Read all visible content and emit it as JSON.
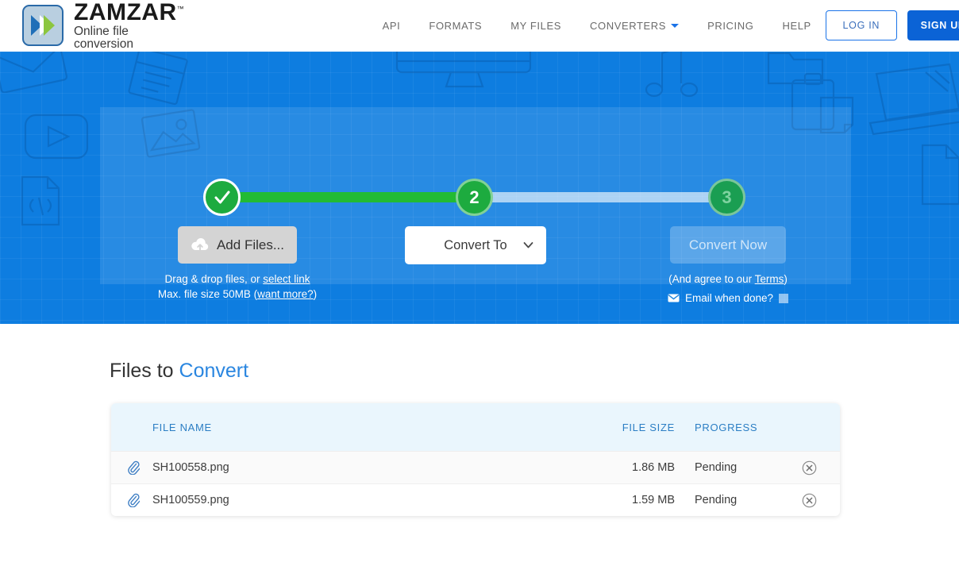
{
  "header": {
    "logo": {
      "name": "ZAMZAR",
      "tm": "™",
      "tagline": "Online file conversion"
    },
    "nav": [
      {
        "label": "API",
        "icon": ""
      },
      {
        "label": "FORMATS",
        "icon": ""
      },
      {
        "label": "MY FILES",
        "icon": ""
      },
      {
        "label": "CONVERTERS",
        "icon": "chevron-down-icon"
      },
      {
        "label": "PRICING",
        "icon": ""
      },
      {
        "label": "HELP",
        "icon": ""
      }
    ],
    "login_label": "LOG IN",
    "signup_label": "SIGN UP"
  },
  "hero": {
    "steps": [
      {
        "id": "1",
        "label": "✓",
        "state": "complete"
      },
      {
        "id": "2",
        "label": "2",
        "state": "active"
      },
      {
        "id": "3",
        "label": "3",
        "state": "upcoming"
      }
    ],
    "step1": {
      "button_label": "Add Files...",
      "icon": "cloud-upload-icon",
      "hint_prefix": "Drag & drop files, or ",
      "hint_link": "select link",
      "limit_prefix": "Max. file size 50MB (",
      "limit_link": "want more?",
      "limit_suffix": ")"
    },
    "step2": {
      "select_value": "Convert To",
      "caret_icon": "chevron-down-icon"
    },
    "step3": {
      "button_label": "Convert Now",
      "terms_prefix": "(And agree to our ",
      "terms_link": "Terms",
      "terms_suffix": ")",
      "email_icon": "envelope-icon",
      "email_label": "Email when done?",
      "email_checked": false
    }
  },
  "files": {
    "title_prefix": "Files to ",
    "title_accent": "Convert",
    "columns": {
      "name": "FILE NAME",
      "size": "FILE SIZE",
      "progress": "PROGRESS"
    },
    "rows": [
      {
        "icon": "paperclip-icon",
        "name": "SH100558.png",
        "size": "1.86 MB",
        "progress": "Pending",
        "remove_icon": "remove-circle-icon"
      },
      {
        "icon": "paperclip-icon",
        "name": "SH100559.png",
        "size": "1.59 MB",
        "progress": "Pending",
        "remove_icon": "remove-circle-icon"
      }
    ]
  },
  "colors": {
    "brand_blue": "#0b63d6",
    "hero_blue": "#0e7de0",
    "accent_blue": "#2a86e0",
    "step_green": "#1dab3f",
    "table_header_bg": "#eaf6fd",
    "table_header_text": "#2b7ec4"
  }
}
